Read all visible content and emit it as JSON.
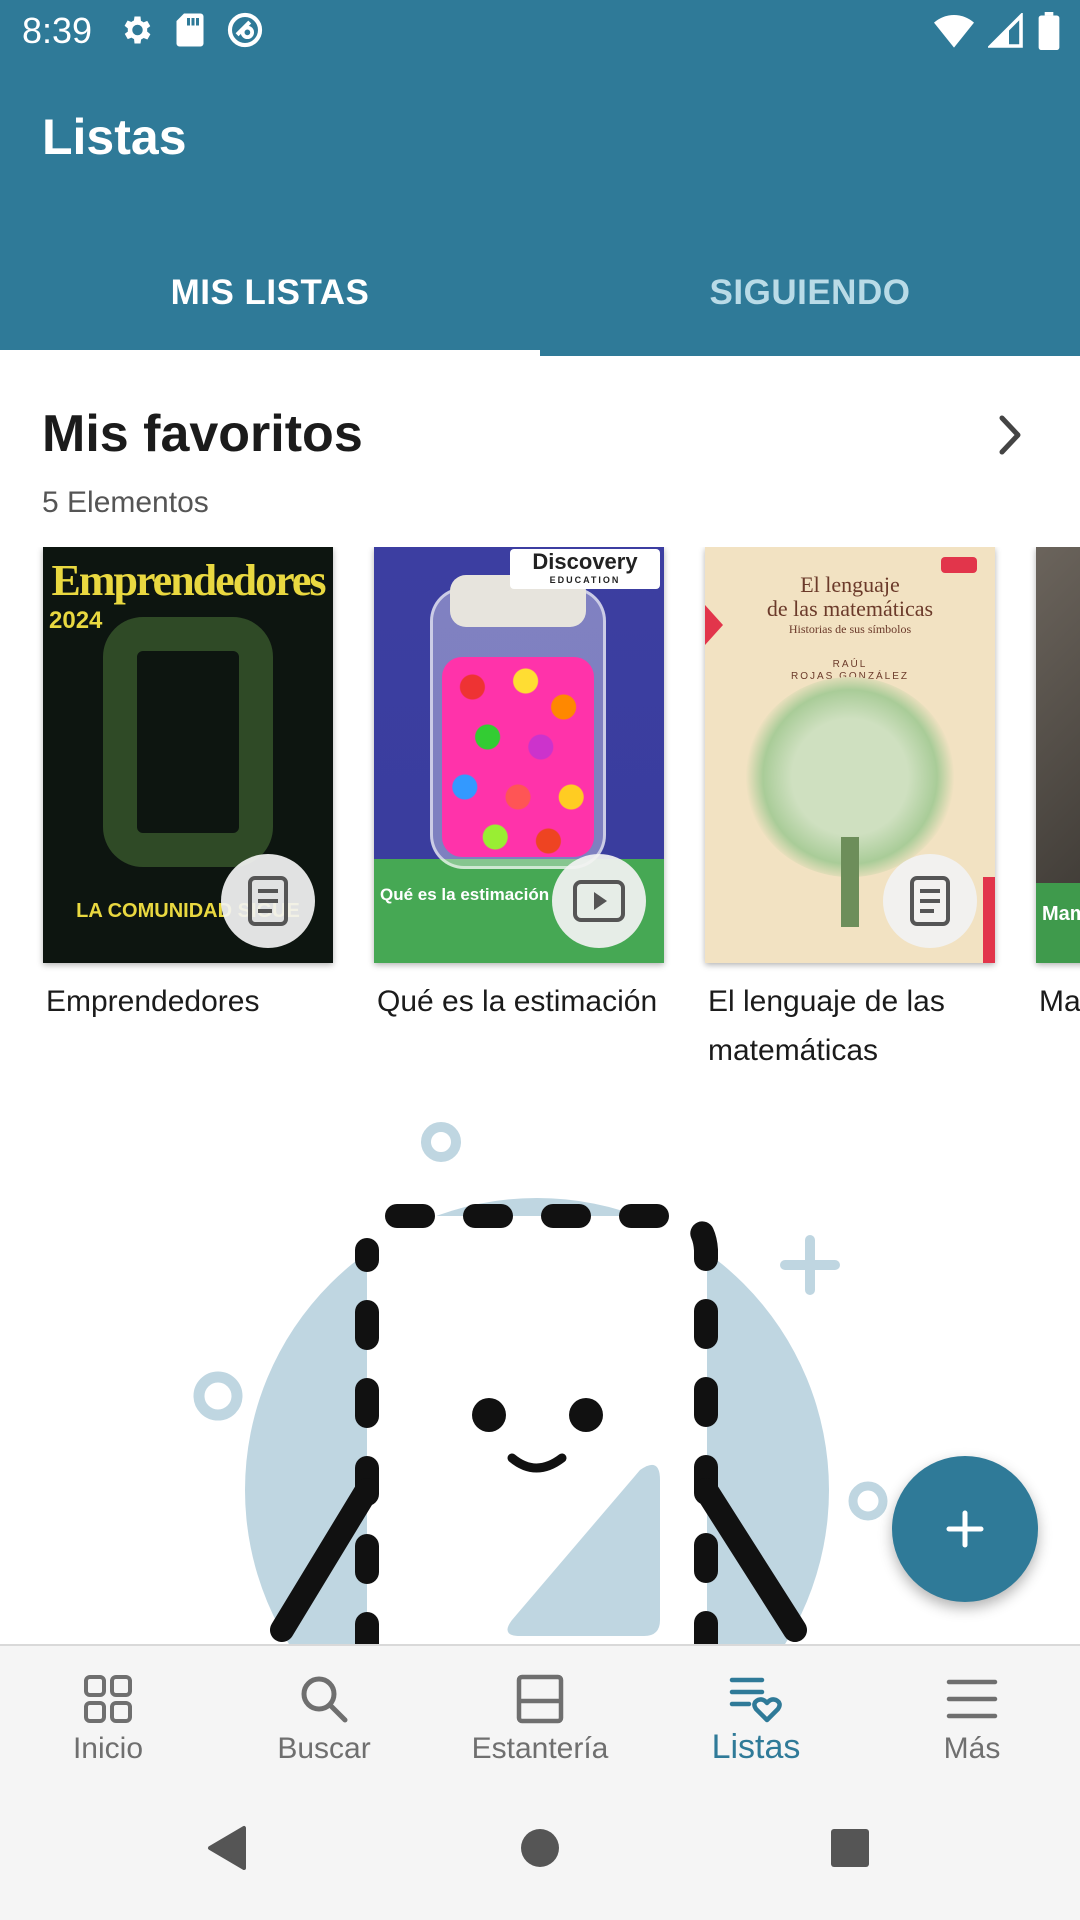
{
  "status_bar": {
    "time": "8:39",
    "left_icons": [
      "settings-icon",
      "sd-card-icon",
      "vpn-key-icon"
    ],
    "right_icons": [
      "wifi-icon",
      "cell-signal-icon",
      "battery-icon"
    ]
  },
  "app_bar": {
    "title": "Listas",
    "background_color": "#2f7a98"
  },
  "tabs": [
    {
      "label": "MIS LISTAS",
      "selected": true
    },
    {
      "label": "SIGUIENDO",
      "selected": false
    }
  ],
  "section": {
    "title": "Mis favoritos",
    "count": "5 Elementos",
    "items": [
      {
        "title": "Emprendedores",
        "type_icon": "document-icon",
        "cover": {
          "title": "Emprendedores",
          "year": "2024",
          "tagline": "LA COMUNIDAD SIGUE"
        }
      },
      {
        "title": "Qué es la estimación",
        "type_icon": "video-icon",
        "cover": {
          "brand": "Discovery",
          "brand_sub": "EDUCATION",
          "caption": "Qué es la estimación"
        }
      },
      {
        "title": "El lenguaje de las matemáticas",
        "type_icon": "document-icon",
        "cover": {
          "title_line1": "El lenguaje",
          "title_line2": "de las matemáticas",
          "subtitle": "Historias de sus símbolos",
          "author_line1": "RAÚL",
          "author_line2": "ROJAS GONZÁLEZ"
        }
      },
      {
        "title": "Ma",
        "type_icon": "",
        "cover": {
          "caption": "Mam"
        }
      }
    ]
  },
  "fab": {
    "icon": "plus-icon"
  },
  "bottom_nav": [
    {
      "label": "Inicio",
      "icon": "grid-icon",
      "active": false
    },
    {
      "label": "Buscar",
      "icon": "search-icon",
      "active": false
    },
    {
      "label": "Estantería",
      "icon": "shelf-icon",
      "active": false
    },
    {
      "label": "Listas",
      "icon": "list-heart-icon",
      "active": true
    },
    {
      "label": "Más",
      "icon": "menu-icon",
      "active": false
    }
  ],
  "colors": {
    "primary": "#2f7a98",
    "illustration_blue": "#bfd6e1",
    "nav_inactive": "#6f6f6f"
  }
}
